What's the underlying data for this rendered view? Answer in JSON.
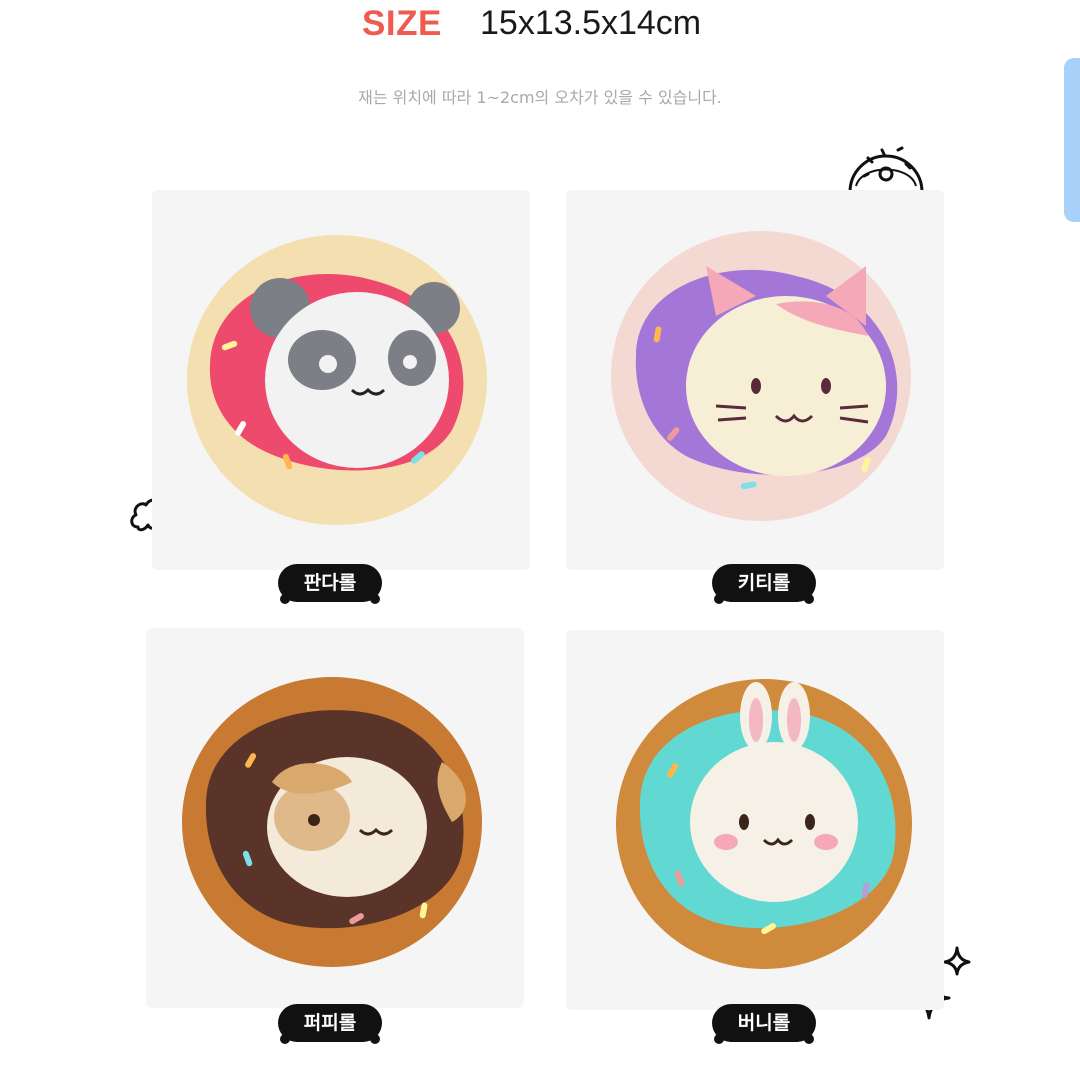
{
  "size": {
    "label": "SIZE",
    "value": "15x13.5x14cm"
  },
  "note": "재는 위치에 따라 1~2cm의 오차가 있을 수 있습니다.",
  "products": [
    {
      "name": "판다롤",
      "icing_color": "#ee4a6e",
      "dough_color": "#f3dfb0",
      "face_color": "#f2f2f2"
    },
    {
      "name": "키티롤",
      "icing_color": "#a476d8",
      "dough_color": "#f4d8d2",
      "face_color": "#f6efd6"
    },
    {
      "name": "퍼피롤",
      "icing_color": "#5a3428",
      "dough_color": "#c87a32",
      "face_color": "#f3eada"
    },
    {
      "name": "버니롤",
      "icing_color": "#62d8d2",
      "dough_color": "#d08a3c",
      "face_color": "#f6f1e7"
    }
  ],
  "decor": [
    "donut-icon",
    "cloud-icon",
    "sparkle-icon"
  ],
  "colors": {
    "accent": "#f05a4f",
    "tag_bg": "#111111",
    "scroll": "#a8d0f8"
  }
}
